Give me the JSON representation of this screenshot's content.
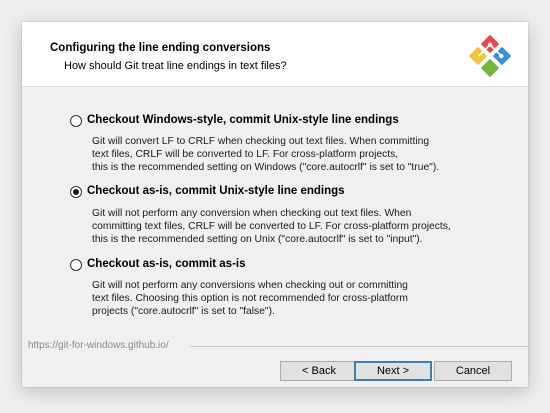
{
  "header": {
    "title": "Configuring the line ending conversions",
    "subtitle": "How should Git treat line endings in text files?"
  },
  "options": [
    {
      "label": "Checkout Windows-style, commit Unix-style line endings",
      "checked": false,
      "description": [
        "Git will convert LF to CRLF when checking out text files. When committing",
        "text files, CRLF will be converted to LF. For cross-platform projects,",
        "this is the recommended setting on Windows (\"core.autocrlf\" is set to \"true\")."
      ]
    },
    {
      "label": "Checkout as-is, commit Unix-style line endings",
      "checked": true,
      "description": [
        "Git will not perform any conversion when checking out text files. When",
        "committing text files, CRLF will be converted to LF. For cross-platform projects,",
        "this is the recommended setting on Unix (\"core.autocrlf\" is set to \"input\")."
      ]
    },
    {
      "label": "Checkout as-is, commit as-is",
      "checked": false,
      "description": [
        "Git will not perform any conversions when checking out or committing",
        "text files. Choosing this option is not recommended for cross-platform",
        "projects (\"core.autocrlf\" is set to \"false\")."
      ]
    }
  ],
  "footer": {
    "url": "https://git-for-windows.github.io/",
    "back_label": "< Back",
    "next_label": "Next >",
    "cancel_label": "Cancel"
  },
  "icons": {
    "logo": "git-for-windows-logo-icon"
  },
  "colors": {
    "logo_red": "#e8474c",
    "logo_blue": "#3a8fd6",
    "logo_green": "#72b83f",
    "logo_yellow": "#f2c53d",
    "default_button_border": "#3c7fb1"
  }
}
